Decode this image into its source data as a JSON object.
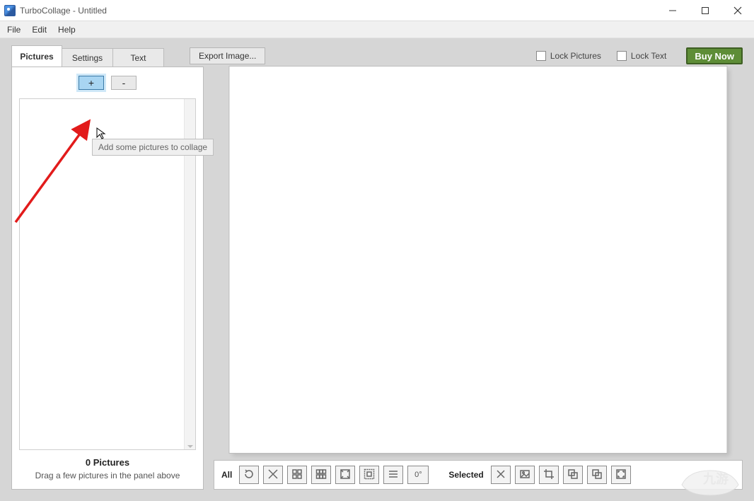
{
  "window": {
    "title": "TurboCollage - Untitled"
  },
  "menubar": {
    "items": [
      "File",
      "Edit",
      "Help"
    ]
  },
  "tabs": {
    "items": [
      "Pictures",
      "Settings",
      "Text"
    ],
    "active_index": 0
  },
  "toolbar": {
    "export_label": "Export Image...",
    "lock_pictures_label": "Lock Pictures",
    "lock_text_label": "Lock Text",
    "lock_pictures_checked": false,
    "lock_text_checked": false,
    "buy_now_label": "Buy Now"
  },
  "pictures_panel": {
    "plus_label": "+",
    "minus_label": "-",
    "tooltip": "Add some pictures to collage",
    "count_text": "0 Pictures",
    "hint_text": "Drag a few pictures in the panel above"
  },
  "bottom_toolbar": {
    "all_label": "All",
    "selected_label": "Selected",
    "zero_deg": "0°",
    "all_tools": [
      "rotate",
      "shuffle",
      "grid-2x2",
      "grid-3x2",
      "fit-screen",
      "fit-all",
      "align-rows",
      "zero-deg"
    ],
    "selected_tools": [
      "delete",
      "image",
      "crop",
      "send-back",
      "bring-front",
      "fullscreen"
    ]
  },
  "annotation": {
    "tooltip_visible": true
  },
  "watermark_text": "九游"
}
